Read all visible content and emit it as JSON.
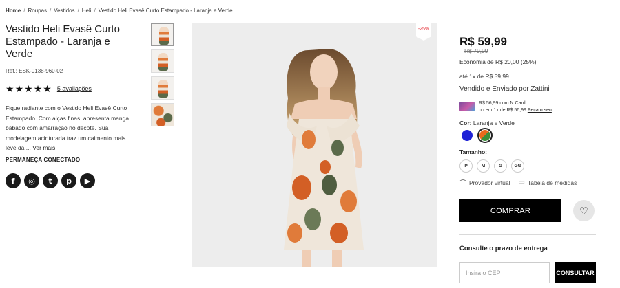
{
  "breadcrumb": {
    "items": [
      "Home",
      "Roupas",
      "Vestidos",
      "Heli",
      "Vestido Heli Evasê Curto Estampado - Laranja e Verde"
    ],
    "separator": "/"
  },
  "product": {
    "title": "Vestido Heli Evasê Curto Estampado - Laranja e Verde",
    "ref": "Ref.: ESK-0138-960-02",
    "rating_stars": 5,
    "reviews_label": "5 avaliações",
    "description": "Fique radiante com o Vestido Heli Evasê Curto Estampado. Com alças finas, apresenta manga babado com amarração no decote. Sua modelagem acinturada traz um caimento mais leve da ...",
    "see_more": "Ver mais.",
    "discount_badge": "-25%"
  },
  "social": {
    "heading": "PERMANEÇA CONECTADO",
    "icons": [
      {
        "name": "facebook-icon",
        "glyph": "f"
      },
      {
        "name": "instagram-icon",
        "glyph": "◎"
      },
      {
        "name": "twitter-icon",
        "glyph": "t"
      },
      {
        "name": "pinterest-icon",
        "glyph": "p"
      },
      {
        "name": "youtube-icon",
        "glyph": "▶"
      }
    ]
  },
  "gallery": {
    "thumbnail_count": 4,
    "selected_index": 0
  },
  "pricing": {
    "price": "R$ 59,99",
    "old_price": "R$ 79,99",
    "economy": "Economia de R$ 20,00 (25%)",
    "installments": "até 1x de R$ 59,99",
    "seller": "Vendido e Enviado por Zattini",
    "card_line1": "R$ 56,99 com N Card.",
    "card_line2": "ou em 1x de R$ 56,99",
    "card_cta": "Peça o seu"
  },
  "options": {
    "color_label": "Cor:",
    "color_value": "Laranja e Verde",
    "colors": [
      {
        "name": "Azul",
        "hex": "#1e22d6"
      },
      {
        "name": "Laranja e Verde",
        "hex": "#e86a1d",
        "secondary": "#3a8f3a",
        "selected": true
      }
    ],
    "size_label": "Tamanho:",
    "sizes": [
      "P",
      "M",
      "G",
      "GG"
    ],
    "virtual_fit": "Provador virtual",
    "size_chart": "Tabela de medidas"
  },
  "actions": {
    "buy": "COMPRAR",
    "delivery_heading": "Consulte o prazo de entrega",
    "cep_placeholder": "Insira o CEP",
    "cep_button": "CONSULTAR"
  },
  "colors": {
    "primary_button": "#000000",
    "discount": "#e3262e"
  }
}
